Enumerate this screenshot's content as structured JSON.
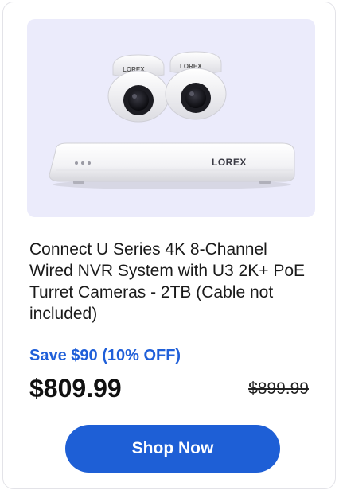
{
  "product": {
    "title": "Connect U Series 4K 8-Channel Wired NVR System with U3 2K+ PoE Turret Cameras - 2TB (Cable not included)",
    "savings_text": "Save $90 (10% OFF)",
    "price": "$809.99",
    "original_price": "$899.99",
    "image": {
      "brand_mark": "LOREX",
      "camera_count": 2,
      "background_color": "#ebebfb"
    }
  },
  "actions": {
    "shop_label": "Shop Now"
  },
  "colors": {
    "accent": "#1e5fd6",
    "savings_text": "#1f5fd9",
    "card_border": "#e3e3e8"
  }
}
